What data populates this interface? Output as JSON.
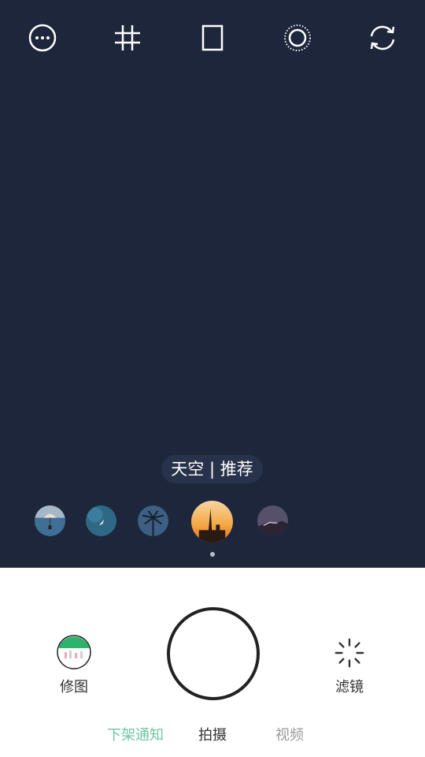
{
  "top_bar": {
    "icons": [
      "more-options-icon",
      "grid-icon",
      "aspect-ratio-icon",
      "timer-icon",
      "switch-camera-icon"
    ]
  },
  "filter": {
    "current_label": "天空 | 推荐",
    "thumbnails": [
      "parachute-sky",
      "bird-sky",
      "palm-tree-sky",
      "city-sunset",
      "mountain-dusk"
    ]
  },
  "actions": {
    "edit_label": "修图",
    "filter_label": "滤镜"
  },
  "modes": {
    "items": [
      "下架通知",
      "拍摄",
      "视频"
    ],
    "active_index": 1
  },
  "colors": {
    "viewfinder": "#1d263b",
    "accent_green": "#6dc7a1",
    "mode_active": "#333333",
    "mode_inactive": "#9a9a9a"
  }
}
